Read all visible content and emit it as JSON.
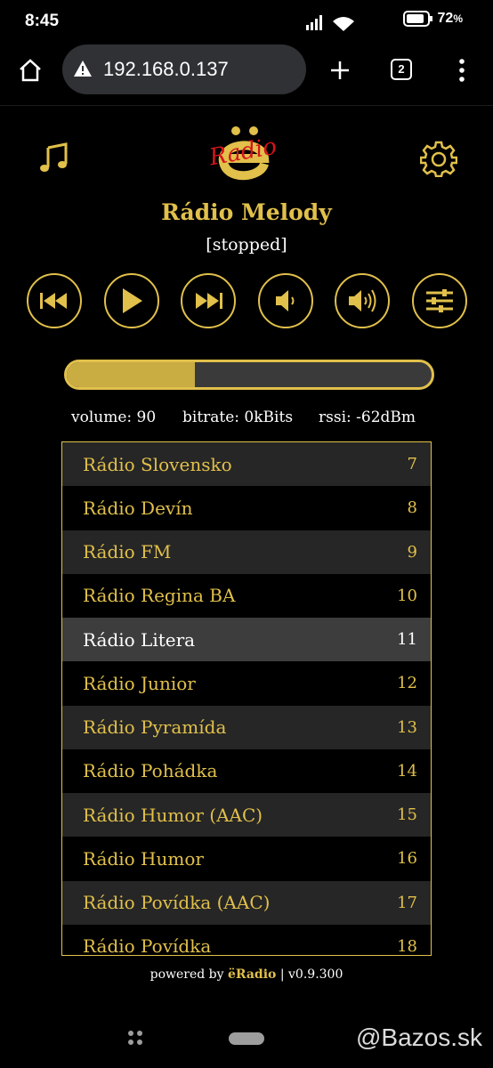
{
  "status_bar": {
    "time": "8:45",
    "battery": "72"
  },
  "browser": {
    "url": "192.168.0.137",
    "tab_count": "2"
  },
  "header": {
    "left_icon": "music-note-icon",
    "logo_text": "Radio",
    "right_icon": "gear-icon"
  },
  "player": {
    "station": "Rádio Melody",
    "state": "[stopped]",
    "volume_fraction": 0.35,
    "stats": {
      "volume": "volume: 90",
      "bitrate": "bitrate: 0kBits",
      "rssi": "rssi: -62dBm"
    }
  },
  "controls": [
    "previous-icon",
    "play-icon",
    "next-icon",
    "volume-down-icon",
    "volume-up-icon",
    "equalizer-icon"
  ],
  "stations": [
    {
      "name": "Rádio Slovensko",
      "num": "7"
    },
    {
      "name": "Rádio Devín",
      "num": "8"
    },
    {
      "name": "Rádio FM",
      "num": "9"
    },
    {
      "name": "Rádio Regina BA",
      "num": "10"
    },
    {
      "name": "Rádio Litera",
      "num": "11"
    },
    {
      "name": "Rádio Junior",
      "num": "12"
    },
    {
      "name": "Rádio Pyramída",
      "num": "13"
    },
    {
      "name": "Rádio Pohádka",
      "num": "14"
    },
    {
      "name": "Rádio Humor (AAC)",
      "num": "15"
    },
    {
      "name": "Rádio Humor",
      "num": "16"
    },
    {
      "name": "Rádio Povídka (AAC)",
      "num": "17"
    },
    {
      "name": "Rádio Povídka",
      "num": "18"
    }
  ],
  "active_station_index": 4,
  "footer": {
    "prefix": "powered by ",
    "brand": "ëRadio",
    "sep": " | ",
    "version": "v0.9.300"
  },
  "watermark": "@Bazos.sk",
  "colors": {
    "accent": "#e1c04b",
    "background": "#000000",
    "logo_red": "#d6141b"
  }
}
